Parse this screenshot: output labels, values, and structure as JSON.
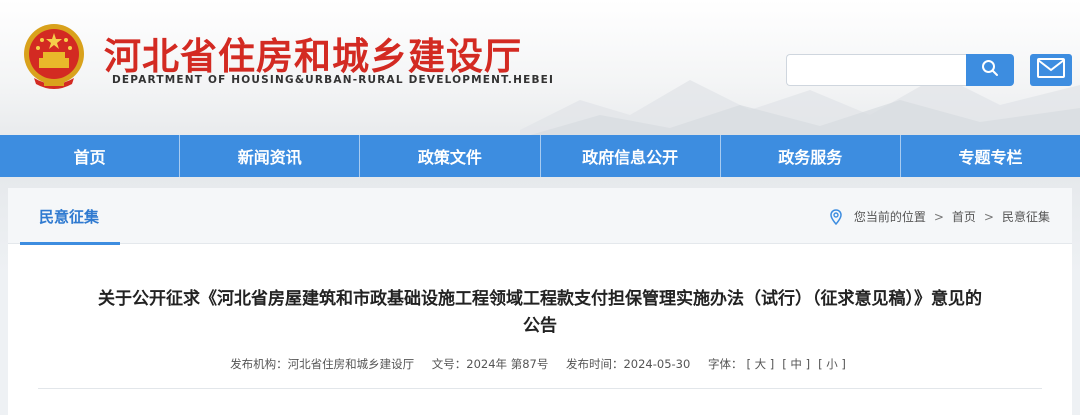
{
  "header": {
    "title": "河北省住房和城乡建设厅",
    "subtitle": "DEPARTMENT OF HOUSING&URBAN-RURAL DEVELOPMENT.HEBEI",
    "search_placeholder": "",
    "brand_color": "#d32a22",
    "accent_color": "#3d8de0"
  },
  "nav": {
    "items": [
      "首页",
      "新闻资讯",
      "政策文件",
      "政府信息公开",
      "政务服务",
      "专题专栏"
    ]
  },
  "section": {
    "title": "民意征集"
  },
  "breadcrumb": {
    "prefix": "您当前的位置",
    "sep": ">",
    "home": "首页",
    "current": "民意征集"
  },
  "article": {
    "title_line1": "关于公开征求《河北省房屋建筑和市政基础设施工程领域工程款支付担保管理实施办法（试行）（征求意见稿）》意见的",
    "title_line2": "公告",
    "meta": {
      "publisher_label": "发布机构：",
      "publisher": "河北省住房和城乡建设厅",
      "docno_label": "文号：",
      "docno": "2024年 第87号",
      "date_label": "发布时间：",
      "date": "2024-05-30",
      "font_label": "字体：",
      "font_large": "[ 大 ]",
      "font_medium": "[ 中 ]",
      "font_small": "[ 小 ]"
    }
  },
  "icons": {
    "emblem": "national-emblem-icon",
    "search": "search-icon",
    "mail": "mail-icon",
    "location": "location-pin-icon"
  }
}
